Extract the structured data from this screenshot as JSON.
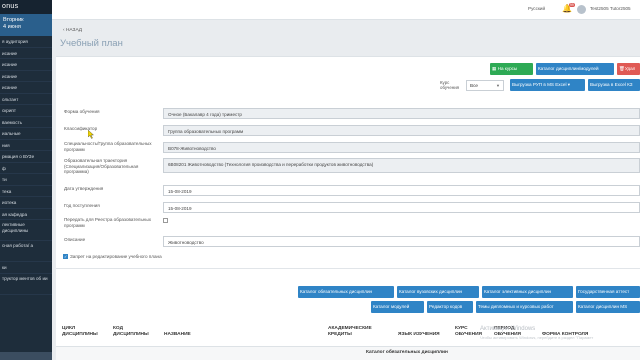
{
  "sidebar": {
    "logo": "onus",
    "date_line1": "Вторник",
    "date_line2": "4 июня",
    "items": [
      "я аудитория",
      "исание",
      "исание",
      "исание",
      "исание",
      "ольтант",
      "скрипт",
      "ваемость",
      "иальные",
      "ния",
      "рмация о ВУЗе",
      "ф",
      "ти",
      "тека",
      "иотека",
      "ая кафедра",
      "лективные дисциплины",
      "сная работа/ а",
      "ки"
    ],
    "bottom_item": "труктор ментов об ии"
  },
  "topbar": {
    "language": "Русский",
    "notifications": "99",
    "username": "Test2505 Tutor2505"
  },
  "header": {
    "back_label": "НАЗАД",
    "title": "Учебный план"
  },
  "toolbar": {
    "to_courses": "На курсы",
    "catalog_disciplines_modules": "Каталог дисциплин/модулей",
    "delete": "Удал",
    "kurs_label_line1": "Курс",
    "kurs_label_line2": "обучения",
    "kurs_value": "Все",
    "export_rup_excel": "Выгрузка РУП в MS Excel",
    "export_excel_short": "Выгрузка в Excel КЗ"
  },
  "form": {
    "form_of_study": {
      "label": "Форма обучения",
      "value": "Очное (Бакалавр 4 года) триместр"
    },
    "classifier": {
      "label": "Классификатор",
      "value": "Группа образовательных программ"
    },
    "specialty": {
      "label": "Специальность/Группа образовательных программ",
      "value": "В078-Животноводство"
    },
    "trajectory": {
      "label": "Образовательная траектория (Специализация/Образовательная программа)",
      "value": "6В08201 Животноводство (Технология производства и переработки продуктов животноводства)"
    },
    "approval_date": {
      "label": "Дата утверждения",
      "value": "15-08-2019"
    },
    "admission_year": {
      "label": "Год поступления",
      "value": "15-08-2019"
    },
    "registry": {
      "label": "Передать для Реестра образовательных программ"
    },
    "description": {
      "label": "Описание",
      "value": "Животноводство"
    },
    "edit_ban": {
      "label": "Запрет на редактирование учебного плана"
    }
  },
  "catalog_buttons": {
    "mandatory": "Каталог обязательных дисциплин",
    "university": "Каталог вузовских дисциплин",
    "elective": "Каталог элективных дисциплин",
    "state_attestation": "Государственная аттест",
    "modules": "Каталог модулей",
    "code_editor": "Редактор кодов",
    "thesis_topics": "Темы дипломных и курсовых работ",
    "ms_catalog": "Каталог дисциплин MS"
  },
  "table": {
    "headers": [
      "ЦИКЛ ДИСЦИПЛИНЫ",
      "КОД ДИСЦИПЛИНЫ",
      "НАЗВАНИЕ",
      "АКАДЕМИЧЕСКИЕ КРЕДИТЫ",
      "ЯЗЫК ИЗУЧЕНИЯ",
      "КУРС ОБУЧЕНИЯ",
      "ПЕРИОД ОБУЧЕНИЯ",
      "ФОРМА КОНТРОЛЯ"
    ],
    "section_title": "Каталог обязательных дисциплин"
  },
  "watermark": {
    "line1": "Активация Windows",
    "line2": "Чтобы активировать Windows, перейдите в раздел \"Парамет"
  },
  "colors": {
    "sidebar_bg": "#1e2d3b",
    "accent_blue": "#2f84c6",
    "accent_green": "#2eaa55",
    "accent_red": "#e05a55"
  }
}
